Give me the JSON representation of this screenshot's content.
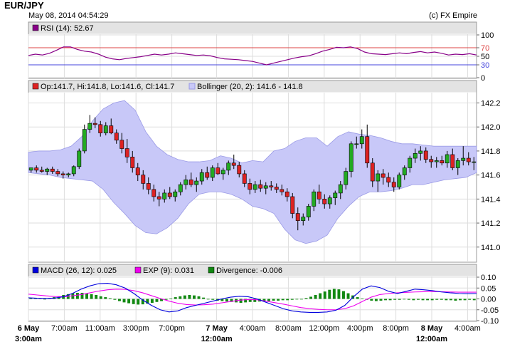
{
  "header": {
    "symbol": "EUR/JPY",
    "timestamp": "May 08, 2014 04:54:29",
    "copyright": "(c) FX Empire"
  },
  "colors": {
    "band": "#c8c8f8",
    "band_edge": "#9a9ae6",
    "up": "#22aa22",
    "down": "#dd2222",
    "rsi": "#880088",
    "macd": "#0000dd",
    "exp": "#ee00ee",
    "divergence": "#118811",
    "panel_header": "#e3e3e3",
    "grid": "#dddddd"
  },
  "chart_data": [
    {
      "type": "line",
      "panel": "rsi",
      "legend": "RSI (14): 52.67",
      "ylim": [
        0,
        100
      ],
      "yticks": [
        0,
        30,
        50,
        70,
        100
      ],
      "ref_lines": [
        {
          "value": 70,
          "color": "#dd4444"
        },
        {
          "value": 30,
          "color": "#4444dd"
        }
      ],
      "x": [
        0,
        4,
        8,
        12,
        16,
        20,
        24,
        28,
        32,
        36,
        40,
        44,
        48,
        52,
        56,
        60,
        64,
        68,
        72,
        76,
        80,
        84,
        88,
        92,
        96,
        100,
        104,
        108,
        112,
        116,
        120,
        124,
        128,
        132,
        136,
        140,
        144,
        148,
        152,
        156,
        160,
        164,
        168,
        172,
        176,
        180,
        184,
        188,
        192,
        196,
        200,
        204,
        208,
        212,
        216,
        220,
        224,
        228,
        232,
        236,
        240,
        244,
        248,
        252,
        256
      ],
      "values": [
        52,
        55,
        53,
        57,
        64,
        72,
        72,
        66,
        62,
        60,
        55,
        48,
        44,
        42,
        45,
        47,
        49,
        52,
        55,
        53,
        55,
        58,
        56,
        54,
        52,
        53,
        51,
        47,
        44,
        43,
        42,
        40,
        38,
        34,
        30,
        34,
        38,
        42,
        46,
        49,
        51,
        56,
        62,
        66,
        71,
        70,
        72,
        68,
        60,
        56,
        55,
        54,
        56,
        58,
        56,
        59,
        61,
        58,
        60,
        57,
        53,
        55,
        54,
        56,
        53
      ]
    },
    {
      "type": "candlestick",
      "panel": "price",
      "legend_ohlc": "Op:141.7, Hi:141.8, Lo:141.6, Cl:141.7",
      "legend_bb": "Bollinger (20, 2): 141.6 - 141.8",
      "ylim": [
        140.88,
        142.28
      ],
      "yticks": [
        141.0,
        141.2,
        141.4,
        141.6,
        141.8,
        142.0,
        142.2
      ],
      "candles": [
        [
          141.64,
          141.66,
          141.62,
          141.66
        ],
        [
          141.66,
          141.68,
          141.62,
          141.64
        ],
        [
          141.64,
          141.67,
          141.62,
          141.63
        ],
        [
          141.63,
          141.66,
          141.6,
          141.65
        ],
        [
          141.65,
          141.67,
          141.61,
          141.63
        ],
        [
          141.63,
          141.65,
          141.59,
          141.61
        ],
        [
          141.61,
          141.63,
          141.57,
          141.6
        ],
        [
          141.6,
          141.62,
          141.58,
          141.61
        ],
        [
          141.61,
          141.68,
          141.59,
          141.67
        ],
        [
          141.67,
          141.82,
          141.65,
          141.8
        ],
        [
          141.8,
          142.02,
          141.78,
          141.98
        ],
        [
          141.98,
          142.1,
          141.95,
          142.03
        ],
        [
          142.03,
          142.08,
          141.99,
          142.02
        ],
        [
          142.02,
          142.05,
          141.92,
          141.95
        ],
        [
          141.95,
          142.04,
          141.93,
          142.01
        ],
        [
          142.01,
          142.07,
          141.94,
          141.95
        ],
        [
          141.95,
          141.98,
          141.86,
          141.89
        ],
        [
          141.89,
          141.95,
          141.78,
          141.82
        ],
        [
          141.82,
          141.9,
          141.7,
          141.75
        ],
        [
          141.75,
          141.8,
          141.62,
          141.66
        ],
        [
          141.66,
          141.7,
          141.55,
          141.6
        ],
        [
          141.6,
          141.64,
          141.48,
          141.53
        ],
        [
          141.53,
          141.58,
          141.44,
          141.48
        ],
        [
          141.48,
          141.52,
          141.38,
          141.42
        ],
        [
          141.42,
          141.46,
          141.34,
          141.4
        ],
        [
          141.4,
          141.48,
          141.37,
          141.45
        ],
        [
          141.45,
          141.5,
          141.4,
          141.42
        ],
        [
          141.42,
          141.48,
          141.38,
          141.46
        ],
        [
          141.46,
          141.54,
          141.43,
          141.52
        ],
        [
          141.52,
          141.6,
          141.48,
          141.56
        ],
        [
          141.56,
          141.62,
          141.5,
          141.52
        ],
        [
          141.52,
          141.58,
          141.46,
          141.55
        ],
        [
          141.55,
          141.65,
          141.52,
          141.62
        ],
        [
          141.62,
          141.67,
          141.56,
          141.58
        ],
        [
          141.58,
          141.68,
          141.55,
          141.66
        ],
        [
          141.66,
          141.7,
          141.6,
          141.61
        ],
        [
          141.61,
          141.66,
          141.56,
          141.64
        ],
        [
          141.64,
          141.72,
          141.6,
          141.7
        ],
        [
          141.7,
          141.77,
          141.65,
          141.68
        ],
        [
          141.68,
          141.71,
          141.58,
          141.61
        ],
        [
          141.61,
          141.64,
          141.5,
          141.53
        ],
        [
          141.53,
          141.57,
          141.44,
          141.48
        ],
        [
          141.48,
          141.55,
          141.45,
          141.52
        ],
        [
          141.52,
          141.56,
          141.46,
          141.49
        ],
        [
          141.49,
          141.54,
          141.44,
          141.51
        ],
        [
          141.51,
          141.55,
          141.47,
          141.5
        ],
        [
          141.5,
          141.53,
          141.45,
          141.48
        ],
        [
          141.48,
          141.52,
          141.43,
          141.46
        ],
        [
          141.46,
          141.49,
          141.38,
          141.42
        ],
        [
          141.42,
          141.45,
          141.24,
          141.28
        ],
        [
          141.28,
          141.33,
          141.14,
          141.22
        ],
        [
          141.22,
          141.28,
          141.18,
          141.25
        ],
        [
          141.25,
          141.36,
          141.22,
          141.34
        ],
        [
          141.34,
          141.48,
          141.3,
          141.46
        ],
        [
          141.46,
          141.52,
          141.36,
          141.4
        ],
        [
          141.4,
          141.44,
          141.32,
          141.36
        ],
        [
          141.36,
          141.43,
          141.32,
          141.41
        ],
        [
          141.41,
          141.47,
          141.35,
          141.45
        ],
        [
          141.45,
          141.55,
          141.4,
          141.52
        ],
        [
          141.52,
          141.66,
          141.48,
          141.63
        ],
        [
          141.63,
          141.88,
          141.58,
          141.86
        ],
        [
          141.86,
          141.92,
          141.82,
          141.86
        ],
        [
          141.86,
          141.98,
          141.82,
          141.92
        ],
        [
          141.92,
          142.02,
          141.66,
          141.7
        ],
        [
          141.7,
          141.74,
          141.5,
          141.55
        ],
        [
          141.55,
          141.64,
          141.46,
          141.61
        ],
        [
          141.61,
          141.65,
          141.52,
          141.58
        ],
        [
          141.58,
          141.62,
          141.5,
          141.54
        ],
        [
          141.54,
          141.58,
          141.46,
          141.5
        ],
        [
          141.5,
          141.62,
          141.48,
          141.6
        ],
        [
          141.6,
          141.68,
          141.56,
          141.66
        ],
        [
          141.66,
          141.76,
          141.62,
          141.74
        ],
        [
          141.74,
          141.82,
          141.7,
          141.78
        ],
        [
          141.78,
          141.84,
          141.72,
          141.8
        ],
        [
          141.8,
          141.83,
          141.7,
          141.73
        ],
        [
          141.73,
          141.76,
          141.66,
          141.71
        ],
        [
          141.71,
          141.75,
          141.66,
          141.72
        ],
        [
          141.72,
          141.76,
          141.68,
          141.7
        ],
        [
          141.7,
          141.8,
          141.66,
          141.77
        ],
        [
          141.77,
          141.82,
          141.64,
          141.66
        ],
        [
          141.66,
          141.74,
          141.6,
          141.72
        ],
        [
          141.72,
          141.84,
          141.68,
          141.74
        ],
        [
          141.74,
          141.79,
          141.68,
          141.71
        ],
        [
          141.71,
          141.75,
          141.64,
          141.71
        ]
      ],
      "bb_upper": [
        141.79,
        141.8,
        141.8,
        141.81,
        141.84,
        141.92,
        142.05,
        142.15,
        142.2,
        142.22,
        142.14,
        141.96,
        141.84,
        141.77,
        141.73,
        141.71,
        141.71,
        141.72,
        141.76,
        141.74,
        141.7,
        141.72,
        141.71,
        141.8,
        141.82,
        141.88,
        141.91,
        141.91,
        141.84,
        141.92,
        141.96,
        141.94,
        141.93,
        141.91,
        141.88,
        141.86,
        141.86,
        141.85,
        141.84,
        141.84,
        141.84,
        141.84,
        141.84
      ],
      "bb_lower": [
        141.62,
        141.61,
        141.6,
        141.58,
        141.57,
        141.56,
        141.55,
        141.48,
        141.37,
        141.28,
        141.18,
        141.12,
        141.11,
        141.16,
        141.24,
        141.36,
        141.44,
        141.46,
        141.46,
        141.44,
        141.4,
        141.34,
        141.32,
        141.28,
        141.15,
        141.06,
        141.03,
        141.05,
        141.1,
        141.24,
        141.34,
        141.42,
        141.46,
        141.46,
        141.47,
        141.49,
        141.52,
        141.52,
        141.54,
        141.56,
        141.57,
        141.58,
        141.62
      ]
    },
    {
      "type": "bar",
      "panel": "macd",
      "legend_macd": "MACD (26, 12): 0.025",
      "legend_exp": "EXP (9): 0.031",
      "legend_div": "Divergence: -0.006",
      "ylim": [
        -0.1,
        0.1
      ],
      "yticks": [
        -0.1,
        -0.05,
        0.0,
        0.05,
        0.1
      ],
      "macd": [
        0.005,
        0.003,
        0.002,
        0.004,
        0.01,
        0.025,
        0.045,
        0.06,
        0.07,
        0.072,
        0.065,
        0.05,
        0.025,
        -0.005,
        -0.03,
        -0.05,
        -0.06,
        -0.055,
        -0.04,
        -0.03,
        -0.02,
        -0.01,
        0.0,
        0.008,
        0.012,
        0.01,
        0.0,
        -0.015,
        -0.03,
        -0.045,
        -0.055,
        -0.06,
        -0.062,
        -0.062,
        -0.06,
        -0.052,
        -0.03,
        0.01,
        0.045,
        0.06,
        0.052,
        0.035,
        0.025,
        0.035,
        0.045,
        0.042,
        0.038,
        0.032,
        0.028,
        0.025,
        0.024,
        0.025
      ],
      "exp": [
        0.022,
        0.018,
        0.014,
        0.011,
        0.01,
        0.014,
        0.02,
        0.028,
        0.036,
        0.042,
        0.045,
        0.044,
        0.038,
        0.028,
        0.015,
        0.002,
        -0.01,
        -0.02,
        -0.026,
        -0.028,
        -0.027,
        -0.024,
        -0.018,
        -0.012,
        -0.006,
        -0.003,
        -0.004,
        -0.01,
        -0.017,
        -0.024,
        -0.032,
        -0.04,
        -0.045,
        -0.048,
        -0.05,
        -0.05,
        -0.045,
        -0.032,
        -0.012,
        0.008,
        0.02,
        0.025,
        0.028,
        0.03,
        0.032,
        0.033,
        0.034,
        0.033,
        0.032,
        0.031,
        0.031,
        0.031
      ],
      "divergence": [
        0.004,
        0.004,
        0.004,
        0.0,
        0.004,
        0.008,
        0.012,
        0.018,
        0.022,
        0.026,
        0.028,
        0.028,
        0.025,
        0.022,
        0.018,
        0.012,
        0.008,
        0.003,
        -0.004,
        -0.01,
        -0.016,
        -0.02,
        -0.024,
        -0.026,
        -0.025,
        -0.022,
        -0.018,
        -0.014,
        -0.01,
        -0.004,
        0.002,
        0.008,
        0.012,
        0.016,
        0.018,
        0.016,
        0.012,
        0.006,
        0.0,
        -0.004,
        -0.008,
        -0.01,
        -0.012,
        -0.014,
        -0.016,
        -0.018,
        -0.016,
        -0.014,
        -0.014,
        -0.012,
        -0.01,
        -0.01,
        -0.008,
        -0.008,
        -0.006,
        -0.006,
        -0.004,
        -0.002,
        0.0,
        0.004,
        0.01,
        0.018,
        0.026,
        0.034,
        0.042,
        0.046,
        0.044,
        0.036,
        0.026,
        0.016,
        0.008,
        0.002,
        -0.004,
        -0.008,
        -0.01,
        -0.008,
        -0.006,
        -0.006,
        -0.004,
        -0.004,
        -0.002,
        -0.004,
        -0.006,
        -0.004,
        -0.006,
        -0.006,
        -0.006,
        -0.004,
        -0.004,
        -0.006,
        -0.006,
        -0.008,
        -0.006,
        -0.006,
        -0.004,
        -0.006
      ]
    }
  ],
  "xaxis": {
    "ticks": [
      {
        "line1": "6 May",
        "line2": "3:00am",
        "bold": true,
        "pos": 0
      },
      {
        "line1": "7:00am",
        "line2": "",
        "bold": false,
        "pos": 4
      },
      {
        "line1": "11:00am",
        "line2": "",
        "bold": false,
        "pos": 8
      },
      {
        "line1": "3:00pm",
        "line2": "",
        "bold": false,
        "pos": 12
      },
      {
        "line1": "7:00pm",
        "line2": "",
        "bold": false,
        "pos": 16
      },
      {
        "line1": "7 May",
        "line2": "12:00am",
        "bold": true,
        "pos": 21
      },
      {
        "line1": "4:00am",
        "line2": "",
        "bold": false,
        "pos": 25
      },
      {
        "line1": "8:00am",
        "line2": "",
        "bold": false,
        "pos": 29
      },
      {
        "line1": "12:00pm",
        "line2": "",
        "bold": false,
        "pos": 33
      },
      {
        "line1": "4:00pm",
        "line2": "",
        "bold": false,
        "pos": 37
      },
      {
        "line1": "8:00pm",
        "line2": "",
        "bold": false,
        "pos": 41
      },
      {
        "line1": "8 May",
        "line2": "12:00am",
        "bold": true,
        "pos": 45
      },
      {
        "line1": "4:00am",
        "line2": "",
        "bold": false,
        "pos": 49
      }
    ],
    "span_hours": 50
  }
}
